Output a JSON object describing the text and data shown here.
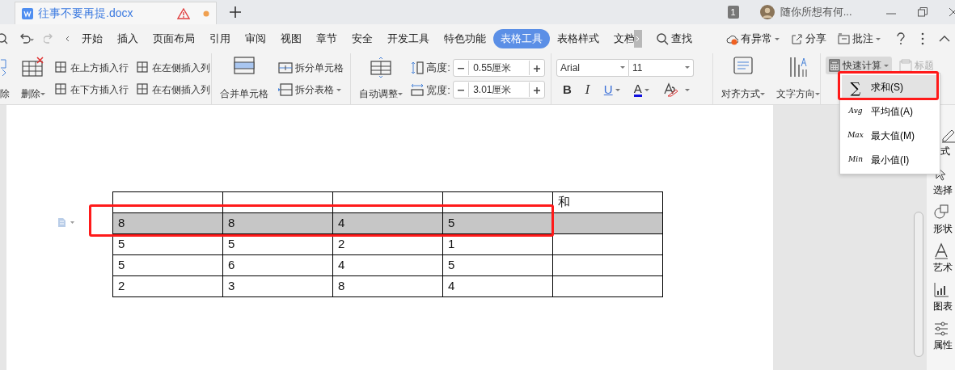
{
  "title_bar": {
    "tab_title": "往事不要再提.docx",
    "unsaved": true,
    "page_count": "1",
    "user_name": "随你所想有何..."
  },
  "menu_tabs": [
    {
      "label": "开始",
      "selected": false
    },
    {
      "label": "插入",
      "selected": false
    },
    {
      "label": "页面布局",
      "selected": false
    },
    {
      "label": "引用",
      "selected": false
    },
    {
      "label": "审阅",
      "selected": false
    },
    {
      "label": "视图",
      "selected": false
    },
    {
      "label": "章节",
      "selected": false
    },
    {
      "label": "安全",
      "selected": false
    },
    {
      "label": "开发工具",
      "selected": false
    },
    {
      "label": "特色功能",
      "selected": false
    },
    {
      "label": "表格工具",
      "selected": true
    },
    {
      "label": "表格样式",
      "selected": false
    },
    {
      "label": "文档",
      "selected": false
    }
  ],
  "menu_actions": [
    {
      "kind": "search",
      "label": "查找"
    },
    {
      "kind": "cloud",
      "label": "有异常"
    },
    {
      "kind": "share",
      "label": "分享"
    },
    {
      "kind": "comment",
      "label": "批注"
    }
  ],
  "ribbon": {
    "delete_cut": "除",
    "delete": "删除",
    "insert_above": "在上方插入行",
    "insert_below": "在下方插入行",
    "insert_left": "在左侧插入列",
    "insert_right": "在右侧插入列",
    "merge": "合并单元格",
    "split_cells": "拆分单元格",
    "split_table": "拆分表格",
    "autofit": "自动调整",
    "height_label": "高度:",
    "height_value": "0.55厘米",
    "width_label": "宽度:",
    "width_value": "3.01厘米",
    "font": "Arial",
    "font_size": "11",
    "bold": "B",
    "italic": "I",
    "underline": "U",
    "font_color": "A",
    "align": "对齐方式",
    "text_direction": "文字方向",
    "quick_calc": "快速计算",
    "title_row": "标题"
  },
  "quick_calc_menu": [
    {
      "mark": "∑",
      "label": "求和(S)",
      "selected": true
    },
    {
      "mark": "Avg",
      "label": "平均值(A)",
      "selected": false
    },
    {
      "mark": "Max",
      "label": "最大值(M)",
      "selected": false
    },
    {
      "mark": "Min",
      "label": "最小值(I)",
      "selected": false
    }
  ],
  "table": {
    "rows": [
      {
        "cells": [
          null,
          null,
          null,
          null,
          "和"
        ],
        "selected": false
      },
      {
        "cells": [
          "8",
          "8",
          "4",
          "5",
          null
        ],
        "selected": true
      },
      {
        "cells": [
          "5",
          "5",
          "2",
          "1",
          null
        ],
        "selected": false
      },
      {
        "cells": [
          "5",
          "6",
          "4",
          "5",
          null
        ],
        "selected": false
      },
      {
        "cells": [
          "2",
          "3",
          "8",
          "4",
          null
        ],
        "selected": false
      }
    ]
  },
  "sidebar": [
    {
      "kind": "style",
      "label": "式"
    },
    {
      "kind": "select",
      "label": "选择"
    },
    {
      "kind": "shape",
      "label": "形状"
    },
    {
      "kind": "art",
      "label": "艺术"
    },
    {
      "kind": "chart",
      "label": "图表"
    },
    {
      "kind": "props",
      "label": "属性"
    }
  ]
}
